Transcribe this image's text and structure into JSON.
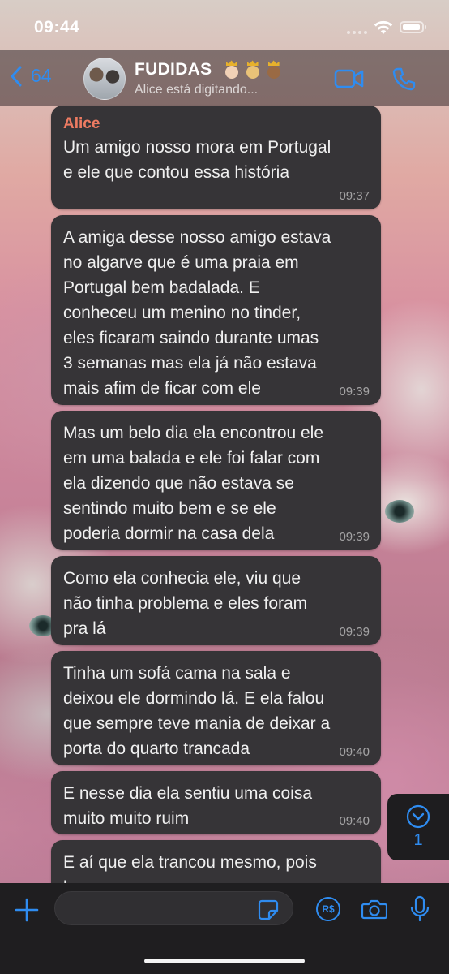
{
  "status_bar": {
    "time": "09:44"
  },
  "header": {
    "back_count": "64",
    "group_name": "FUDIDAS",
    "subtitle": "Alice está digitando..."
  },
  "messages": [
    {
      "sender": "Alice",
      "text": "Um amigo nosso mora em Portugal\ne ele que contou essa história",
      "time": "09:37"
    },
    {
      "sender": "",
      "text": "A amiga desse nosso amigo estava\nno algarve que é uma praia em\nPortugal bem badalada. E\nconheceu um menino no tinder,\neles ficaram saindo durante umas\n3 semanas mas ela já não estava\nmais afim de ficar com ele",
      "time": "09:39"
    },
    {
      "sender": "",
      "text": "Mas um belo dia ela encontrou ele\nem uma balada e ele foi falar com\nela dizendo que não estava se\nsentindo muito bem e se ele\npoderia dormir na casa dela",
      "time": "09:39"
    },
    {
      "sender": "",
      "text": "Como ela conhecia ele, viu que\nnão tinha problema e eles foram\npra lá",
      "time": "09:39"
    },
    {
      "sender": "",
      "text": "Tinha um sofá cama na sala e\ndeixou ele dormindo lá. E ela falou\nque sempre teve mania de deixar a\nporta do quarto trancada",
      "time": "09:40"
    },
    {
      "sender": "",
      "text": "E nesse dia ela sentiu uma coisa\nmuito muito ruim",
      "time": "09:40"
    },
    {
      "sender": "",
      "text": "E aí que ela trancou mesmo, pois\nbem",
      "time": ""
    }
  ],
  "scroll_down": {
    "unread_count": "1"
  },
  "input_bar": {
    "message_value": "",
    "pay_label": "R$"
  },
  "icons": {
    "back": "chevron-left-icon",
    "video": "video-camera-icon",
    "phone": "phone-icon",
    "plus": "plus-icon",
    "sticker": "sticker-icon",
    "payment": "payment-icon",
    "camera": "camera-icon",
    "mic": "microphone-icon",
    "scroll_down": "chevron-down-circle-icon"
  },
  "colors": {
    "accent": "#2f8cf0",
    "bubble": "#363437",
    "sender_name": "#ee7b62",
    "header_bg": "#372c2e"
  }
}
